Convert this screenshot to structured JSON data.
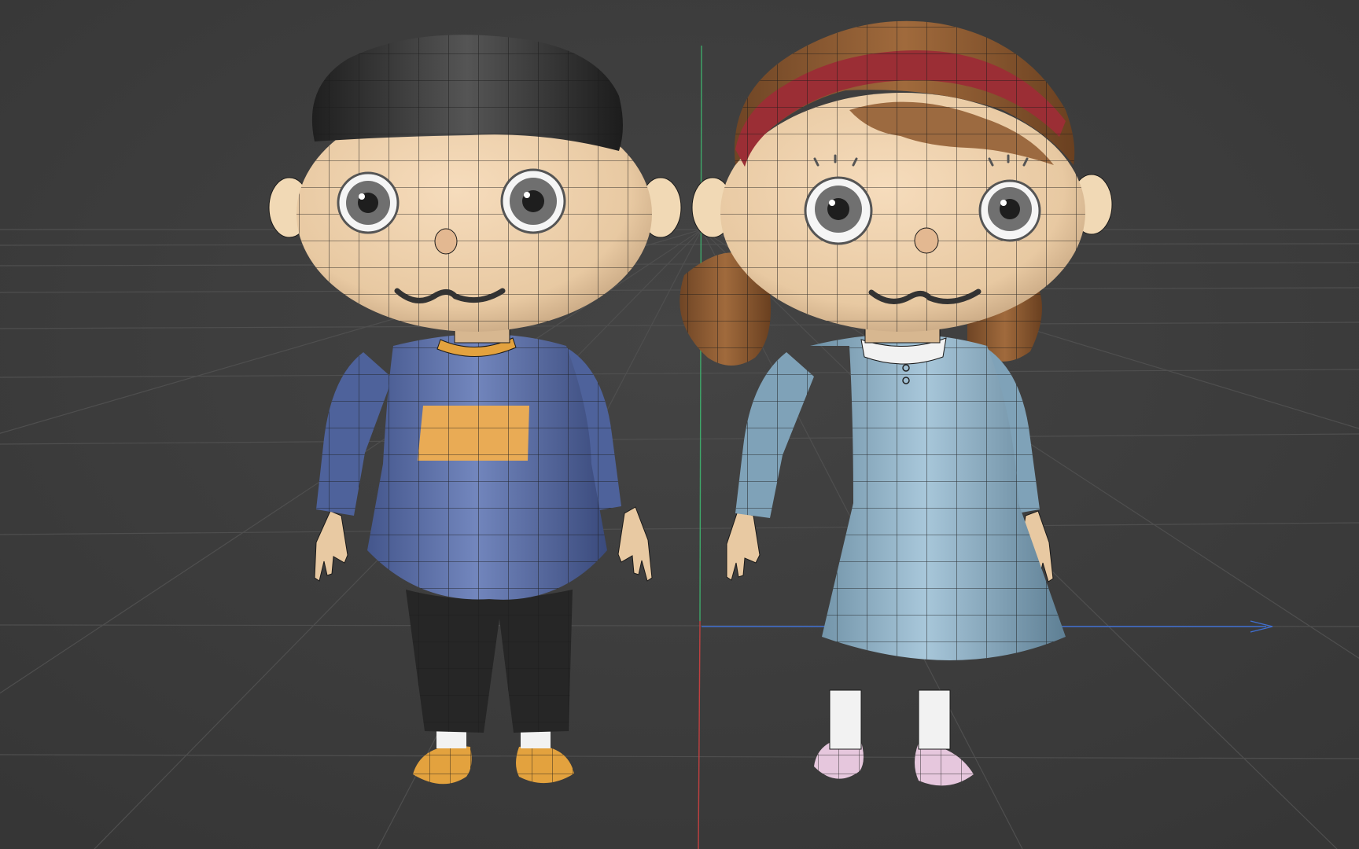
{
  "viewport": {
    "mode": "perspective",
    "background_color": "#3d3d3d",
    "grid_color": "#4e4e4e",
    "axis_x_color": "#3f6fd1",
    "axis_y_color": "#3fa86a",
    "axis_neg_color": "#c04040",
    "wireframe_color": "#1a1a1a"
  },
  "objects": [
    {
      "name": "boy",
      "colors": {
        "skin": "#e8c9a2",
        "hair": "#2c2c2c",
        "shirt": "#5a6ea8",
        "shirt_patch": "#e9ab55",
        "pants": "#262626",
        "shoes": "#e3a23e",
        "socks": "#f2f2f2"
      }
    },
    {
      "name": "girl",
      "colors": {
        "skin": "#e8c9a2",
        "hair": "#8a5a32",
        "headband": "#9b2e35",
        "dress": "#93b6cc",
        "collar": "#f2f2f2",
        "shoes": "#e6c7dd",
        "socks": "#f2f2f2"
      }
    }
  ]
}
